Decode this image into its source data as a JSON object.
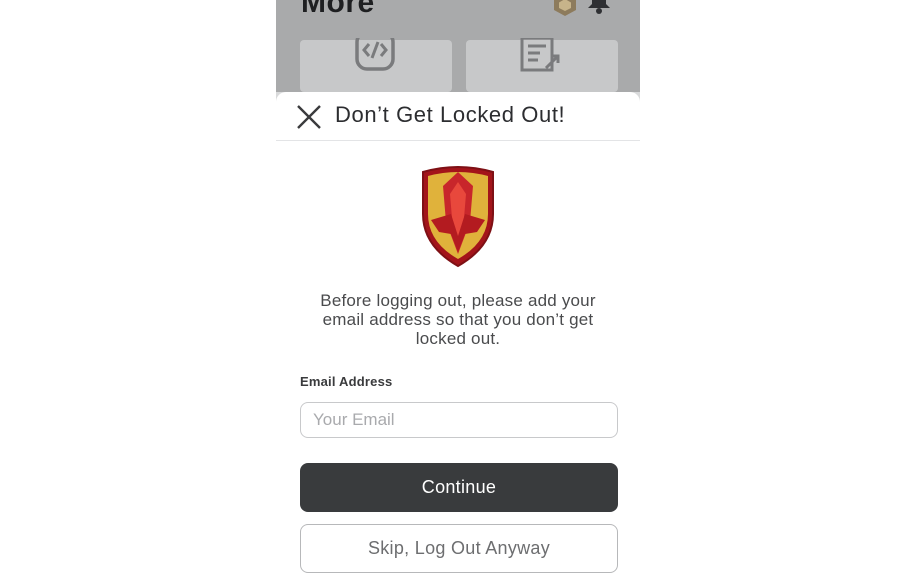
{
  "background": {
    "page_title": "More",
    "icons": [
      "robux-icon",
      "notification-bell-icon",
      "develop-icon",
      "blog-icon"
    ]
  },
  "modal": {
    "title": "Don’t Get Locked Out!",
    "description": "Before logging out, please add your email address so that you don’t get locked out.",
    "email_label": "Email Address",
    "email_placeholder": "Your Email",
    "email_value": "",
    "continue_label": "Continue",
    "skip_label": "Skip, Log Out Anyway"
  },
  "colors": {
    "primary_button": "#393b3d",
    "shield_red": "#c8262b",
    "shield_gold": "#e0b23b"
  }
}
